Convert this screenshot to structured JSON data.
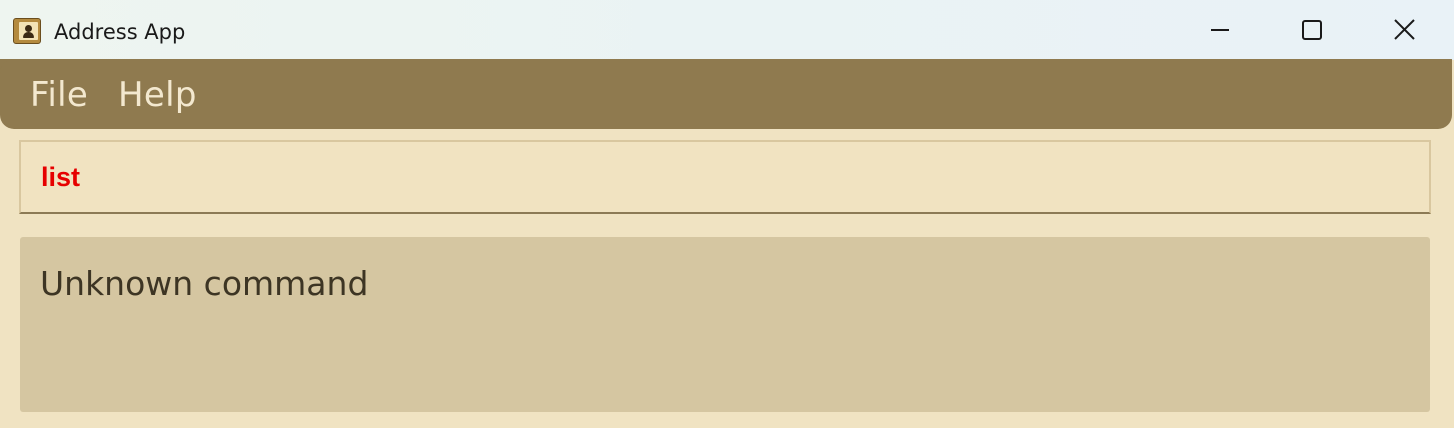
{
  "window": {
    "title": "Address App",
    "icon": "address-book-icon",
    "controls": [
      "minimize-icon",
      "maximize-icon",
      "close-icon"
    ]
  },
  "menu": {
    "items": [
      {
        "label": "File"
      },
      {
        "label": "Help"
      }
    ]
  },
  "command": {
    "value": "list",
    "text_color": "#e60000"
  },
  "result": {
    "text": "Unknown command"
  },
  "colors": {
    "menu_background": "#8f7a4f",
    "window_background": "#f0e3c2",
    "result_background": "#d5c6a1"
  }
}
